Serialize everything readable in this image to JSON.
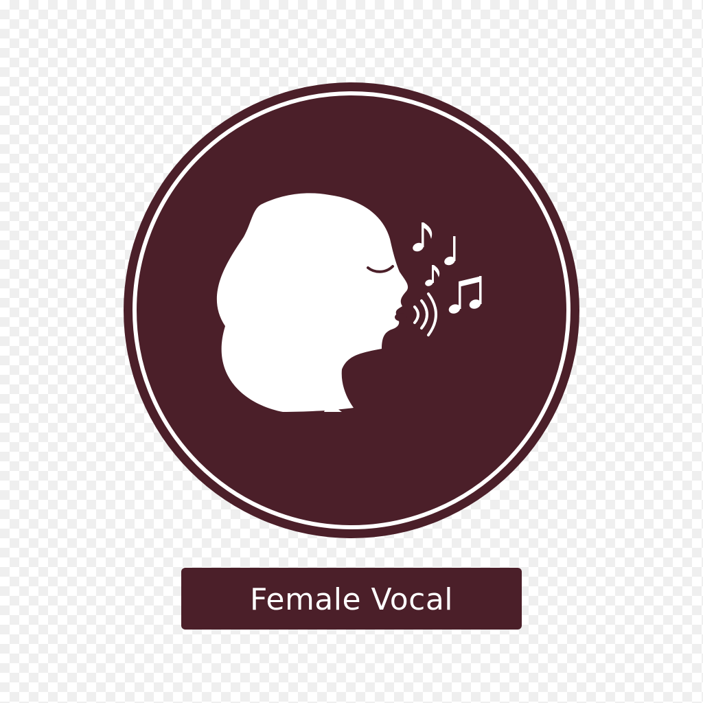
{
  "badge": {
    "icon": "female-singer-icon",
    "note_icons": [
      "eighth-note-icon",
      "quarter-note-icon",
      "small-eighth-note-icon",
      "beamed-notes-icon"
    ],
    "sound_icon": "sound-waves-icon"
  },
  "label": {
    "text": "Female Vocal"
  },
  "colors": {
    "badge_fill": "#4b1f29",
    "ring": "#ffffff",
    "silhouette": "#ffffff",
    "label_bg": "#4b1f29",
    "label_text": "#ffffff"
  }
}
